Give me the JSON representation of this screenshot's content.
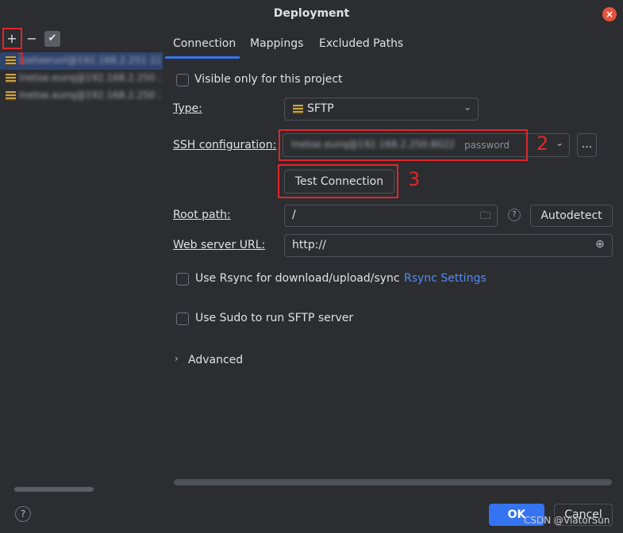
{
  "window": {
    "title": "Deployment",
    "close_glyph": "×"
  },
  "left_toolbar": {
    "add": "+",
    "remove": "−",
    "check": "✔"
  },
  "servers": [
    {
      "name": "lnetoerunl@192.168.2.251 22",
      "selected": true
    },
    {
      "name": "lnetoe.eunq@192.168.2.250 22"
    },
    {
      "name": "lnetoe.eunq@192.168.2.250 22"
    }
  ],
  "tabs": [
    "Connection",
    "Mappings",
    "Excluded Paths"
  ],
  "form": {
    "visible_only": "Visible only for this project",
    "type_label": "Type:",
    "type_value": "SFTP",
    "ssh_label": "SSH configuration:",
    "ssh_value": "lnetoe.eunq@192.168.2.250:8022",
    "ssh_suffix": "password",
    "ellipsis": "...",
    "test_connection": "Test Connection",
    "root_path_label": "Root path:",
    "root_path_value": "/",
    "autodetect": "Autodetect",
    "web_url_label": "Web server URL:",
    "web_url_value": "http://",
    "rsync_label": "Use Rsync for download/upload/sync",
    "rsync_link": "Rsync Settings",
    "sudo_label": "Use Sudo to run SFTP server",
    "advanced": "Advanced"
  },
  "annotations": {
    "n1": "1",
    "n2": "2",
    "n3": "3"
  },
  "footer": {
    "help": "?",
    "ok": "OK",
    "cancel": "Cancel"
  },
  "watermark": "CSDN @ViatorSun",
  "colors": {
    "accent": "#3574f0",
    "annotation_red": "#e0262b",
    "close": "#e5533b"
  }
}
